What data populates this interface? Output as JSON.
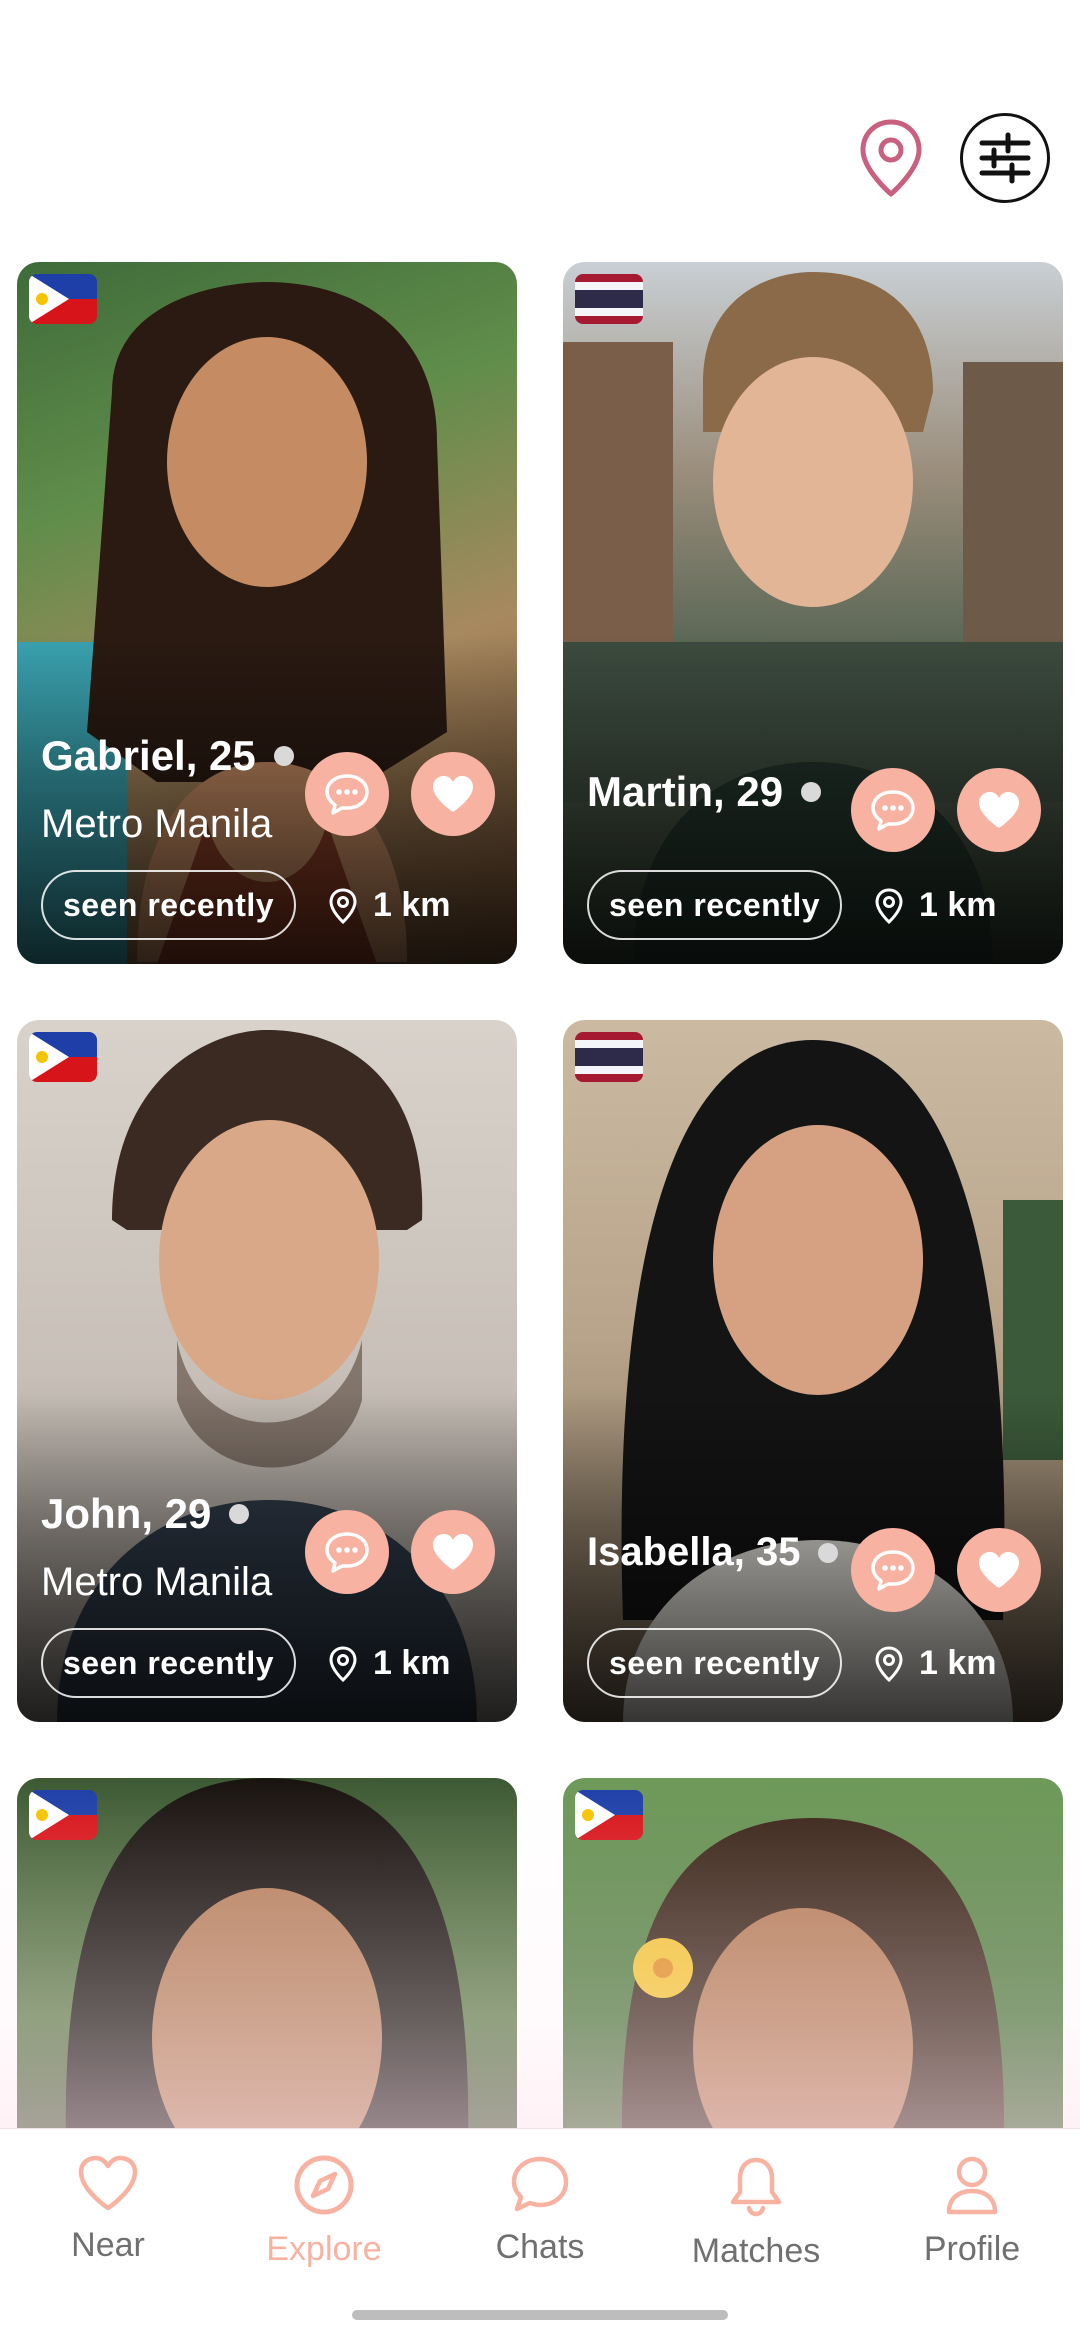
{
  "header": {
    "location_icon": "map-pin-icon",
    "filter_icon": "sliders-icon"
  },
  "profiles": [
    {
      "name_age": "Gabriel, 25",
      "city": "Metro Manila",
      "status": "seen recently",
      "distance": "1 km",
      "flag": "philippines"
    },
    {
      "name_age": "Martin, 29",
      "city": "",
      "status": "seen recently",
      "distance": "1 km",
      "flag": "thailand"
    },
    {
      "name_age": "John, 29",
      "city": "Metro Manila",
      "status": "seen recently",
      "distance": "1 km",
      "flag": "philippines"
    },
    {
      "name_age": "Isabella, 35",
      "city": "",
      "status": "seen recently",
      "distance": "1 km",
      "flag": "thailand"
    },
    {
      "flag": "philippines"
    },
    {
      "flag": "philippines"
    }
  ],
  "bottom_nav": [
    {
      "label": "Near",
      "icon": "heart-icon"
    },
    {
      "label": "Explore",
      "icon": "compass-icon",
      "active": true
    },
    {
      "label": "Chats",
      "icon": "chat-bubble-icon"
    },
    {
      "label": "Matches",
      "icon": "bell-icon"
    },
    {
      "label": "Profile",
      "icon": "user-icon"
    }
  ],
  "colors": {
    "accent": "#f7b2a2",
    "pin": "#c9607f",
    "text_muted": "#707070"
  }
}
